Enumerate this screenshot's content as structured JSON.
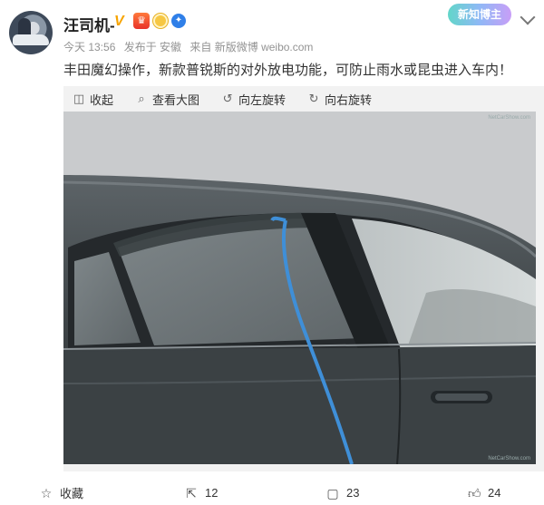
{
  "user": {
    "name": "汪司机-",
    "badge_v": "V"
  },
  "meta": {
    "time": "今天 13:56",
    "location": "发布于 安徽",
    "source": "来自 新版微博 weibo.com"
  },
  "newbie_badge": "新知博主",
  "post": {
    "text": "丰田魔幻操作，新款普锐斯的对外放电功能，可防止雨水或昆虫进入车内！"
  },
  "toolbar": {
    "collapse": "收起",
    "view_large": "查看大图",
    "rotate_left": "向左旋转",
    "rotate_right": "向右旋转"
  },
  "photo": {
    "watermark_top": "NetCarShow.com",
    "watermark_bottom": "NetCarShow.com"
  },
  "footer": {
    "favorite": "收藏",
    "repost_count": "12",
    "comment_count": "23",
    "like_count": "24"
  }
}
